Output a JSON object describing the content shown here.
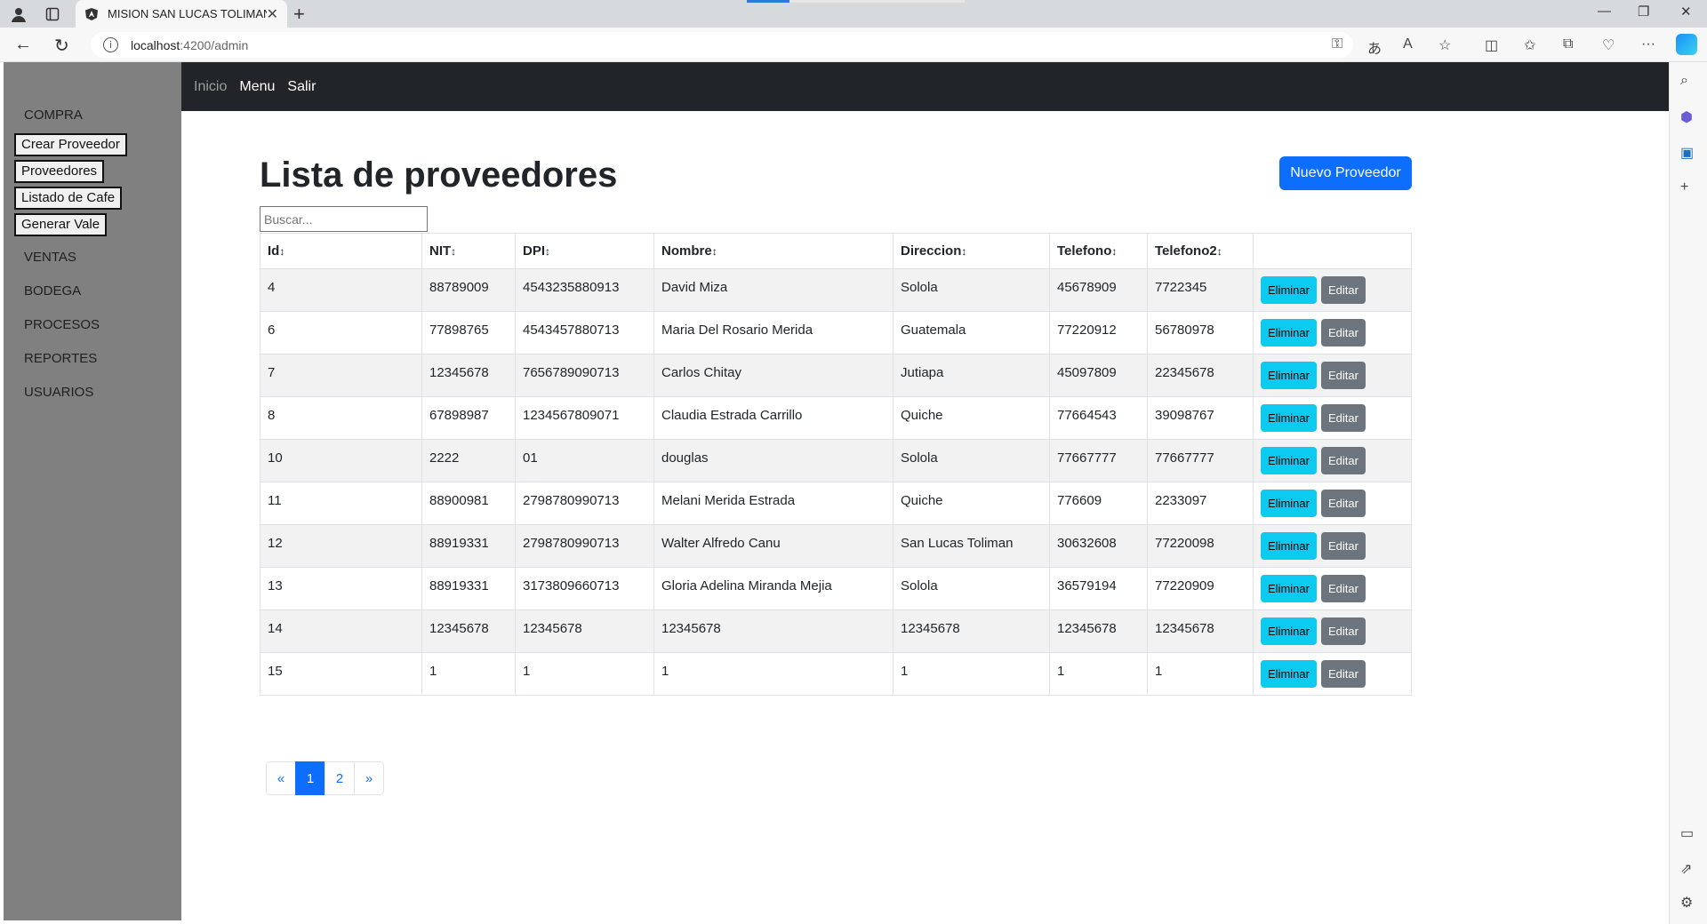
{
  "browser": {
    "tab_title": "MISION SAN LUCAS TOLIMAN",
    "url_host": "localhost",
    "url_path": ":4200/admin"
  },
  "nav": {
    "items": [
      {
        "label": "Inicio",
        "muted": true
      },
      {
        "label": "Menu",
        "muted": false
      },
      {
        "label": "Salir",
        "muted": false
      }
    ]
  },
  "sidebar": {
    "compra": "COMPRA",
    "buttons": [
      "Crear Proveedor",
      "Proveedores",
      "Listado de Cafe",
      "Generar Vale"
    ],
    "sections": [
      "VENTAS",
      "BODEGA",
      "PROCESOS",
      "REPORTES",
      "USUARIOS"
    ]
  },
  "page": {
    "title": "Lista de proveedores",
    "new_button": "Nuevo Proveedor",
    "search_placeholder": "Buscar..."
  },
  "table": {
    "columns": [
      "Id",
      "NIT",
      "DPI",
      "Nombre",
      "Direccion",
      "Telefono",
      "Telefono2"
    ],
    "sort_glyph": "↕",
    "delete_label": "Eliminar",
    "edit_label": "Editar",
    "rows": [
      [
        "4",
        "88789009",
        "4543235880913",
        "David Miza",
        "Solola",
        "45678909",
        "7722345"
      ],
      [
        "6",
        "77898765",
        "4543457880713",
        "Maria Del Rosario Merida",
        "Guatemala",
        "77220912",
        "56780978"
      ],
      [
        "7",
        "12345678",
        "7656789090713",
        "Carlos Chitay",
        "Jutiapa",
        "45097809",
        "22345678"
      ],
      [
        "8",
        "67898987",
        "1234567809071",
        "Claudia Estrada Carrillo",
        "Quiche",
        "77664543",
        "39098767"
      ],
      [
        "10",
        "2222",
        "01",
        "douglas",
        "Solola",
        "77667777",
        "77667777"
      ],
      [
        "11",
        "88900981",
        "2798780990713",
        "Melani Merida Estrada",
        "Quiche",
        "776609",
        "2233097"
      ],
      [
        "12",
        "88919331",
        "2798780990713",
        "Walter Alfredo Canu",
        "San Lucas Toliman",
        "30632608",
        "77220098"
      ],
      [
        "13",
        "88919331",
        "3173809660713",
        "Gloria Adelina Miranda Mejia",
        "Solola",
        "36579194",
        "77220909"
      ],
      [
        "14",
        "12345678",
        "12345678",
        "12345678",
        "12345678",
        "12345678",
        "12345678"
      ],
      [
        "15",
        "1",
        "1",
        "1",
        "1",
        "1",
        "1"
      ]
    ]
  },
  "pagination": {
    "prev": "«",
    "pages": [
      "1",
      "2"
    ],
    "active_page": "1",
    "next": "»"
  },
  "colors": {
    "primary": "#0d6efd",
    "info": "#0dcaf0",
    "secondary": "#6c757d",
    "navbar": "#212529",
    "sidebar": "#808080"
  }
}
